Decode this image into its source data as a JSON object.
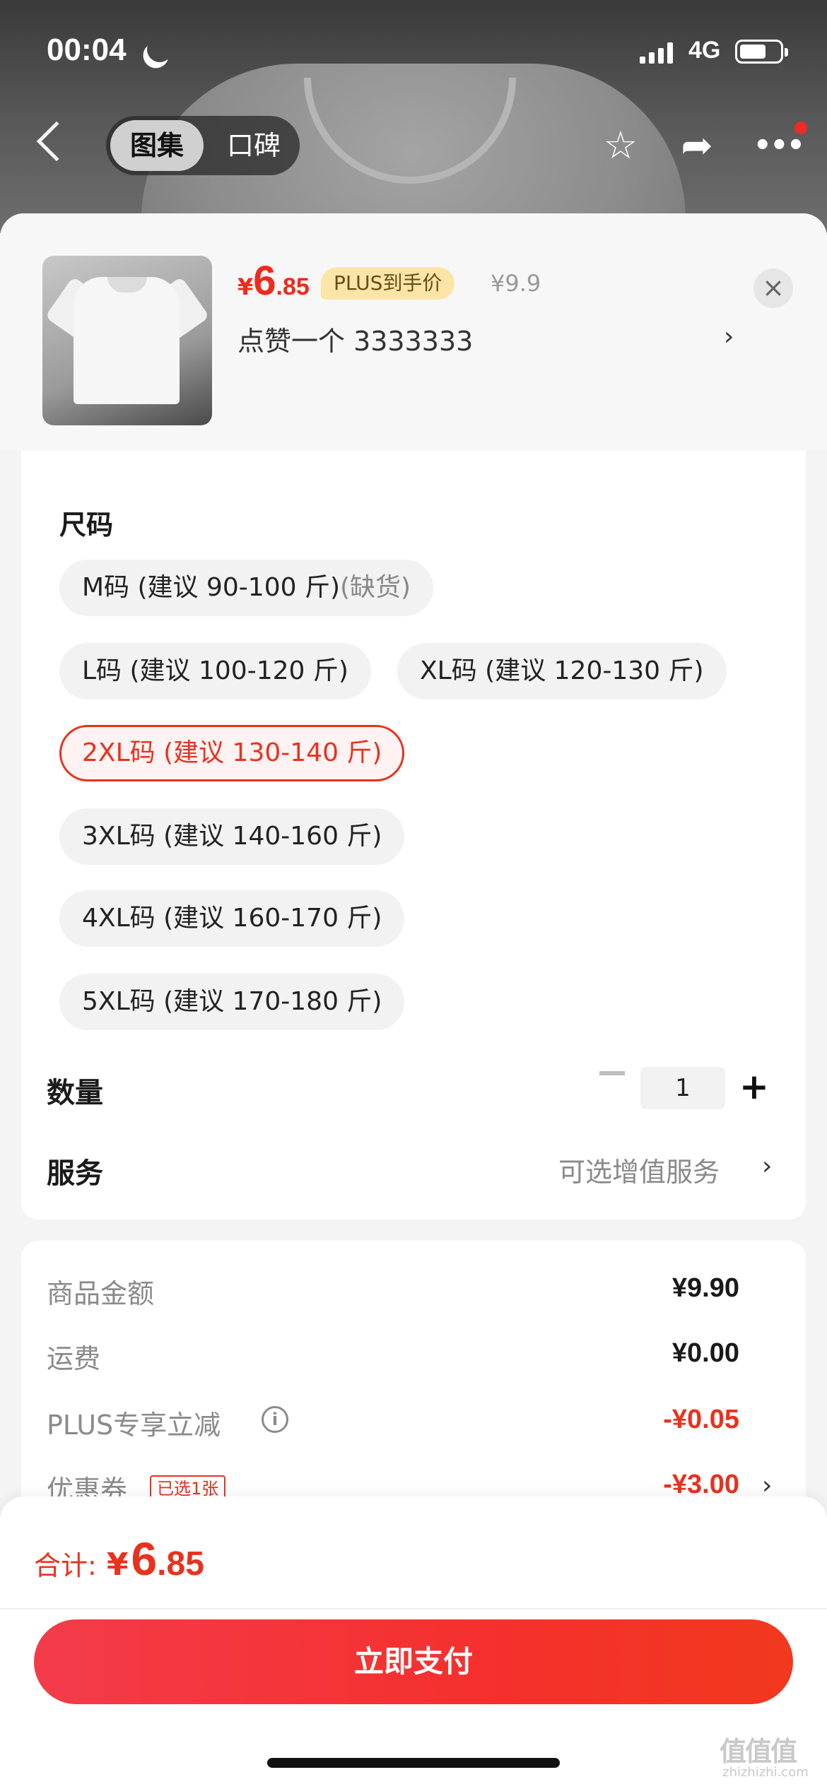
{
  "status_bar": {
    "time": "00:04",
    "network": "4G"
  },
  "nav": {
    "tab_gallery": "图集",
    "tab_reviews": "口碑"
  },
  "product": {
    "price_yen": "¥",
    "price_int": "6",
    "price_dec": ".85",
    "plus_tag": "PLUS到手价",
    "original_price": "¥9.9",
    "selected_spec": "点赞一个  3333333"
  },
  "size_section": {
    "title": "尺码",
    "options": [
      {
        "label": "M码 (建议 90-100 斤)",
        "suffix": "(缺货)",
        "state": "out_of_stock"
      },
      {
        "label": "L码 (建议 100-120 斤)",
        "state": "normal"
      },
      {
        "label": "XL码 (建议 120-130 斤)",
        "state": "normal"
      },
      {
        "label": "2XL码 (建议 130-140 斤)",
        "state": "selected"
      },
      {
        "label": "3XL码 (建议 140-160 斤)",
        "state": "normal"
      },
      {
        "label": "4XL码 (建议 160-170 斤)",
        "state": "normal"
      },
      {
        "label": "5XL码 (建议 170-180 斤)",
        "state": "normal"
      }
    ]
  },
  "quantity": {
    "label": "数量",
    "value": "1",
    "minus": "−",
    "plus": "+"
  },
  "service": {
    "label": "服务",
    "value": "可选增值服务"
  },
  "summary": {
    "goods_label": "商品金额",
    "goods_value": "¥9.90",
    "shipping_label": "运费",
    "shipping_value": "¥0.00",
    "plus_label": "PLUS专享立减",
    "plus_value": "-¥0.05",
    "coupon_label": "优惠券",
    "coupon_tag": "已选1张",
    "coupon_value": "-¥3.00"
  },
  "footer": {
    "total_label": "合计:",
    "total_yen": "¥",
    "total_int": "6",
    "total_dec": ".85",
    "pay_button": "立即支付"
  },
  "watermark": {
    "text": "值值值",
    "sub": "zhizhizhi.com"
  },
  "colors": {
    "accent_red": "#e8321e",
    "plus_gold": "#fbe6a8"
  }
}
